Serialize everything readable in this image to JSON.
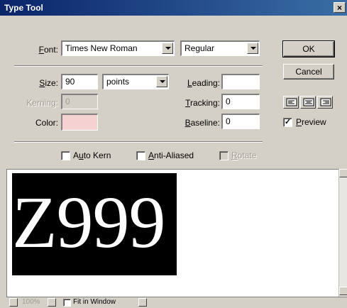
{
  "window": {
    "title": "Type Tool",
    "close_glyph": "×"
  },
  "font": {
    "label_prefix": "",
    "label_u": "F",
    "label_rest": "ont:",
    "family": "Times New Roman",
    "style": "Regular"
  },
  "size": {
    "label_u": "S",
    "label_rest": "ize:",
    "value": "90",
    "units": "points"
  },
  "leading": {
    "label_u": "L",
    "label_rest": "eading:",
    "value": ""
  },
  "kerning": {
    "label": "Kerning:",
    "value": "0"
  },
  "tracking": {
    "label_u": "T",
    "label_rest": "racking:",
    "value": "0"
  },
  "color": {
    "label": "Color:",
    "swatch": "#f4d2d2"
  },
  "baseline": {
    "label_u": "B",
    "label_rest": "aseline:",
    "value": "0"
  },
  "buttons": {
    "ok": "OK",
    "cancel": "Cancel"
  },
  "preview_check": {
    "label_u": "P",
    "label_rest": "review",
    "checked": true,
    "mark": "✓"
  },
  "checks": {
    "auto_kern": {
      "label_a": "A",
      "label_u": "u",
      "label_b": "to Kern",
      "checked": false
    },
    "anti_aliased": {
      "label_u": "A",
      "label_b": "nti-Aliased",
      "checked": false
    },
    "rotate": {
      "label_u": "R",
      "label_b": "otate",
      "checked": false
    }
  },
  "preview": {
    "text": "Z999"
  },
  "status": {
    "zoom": "100%",
    "fit_label": "Fit in Window"
  }
}
